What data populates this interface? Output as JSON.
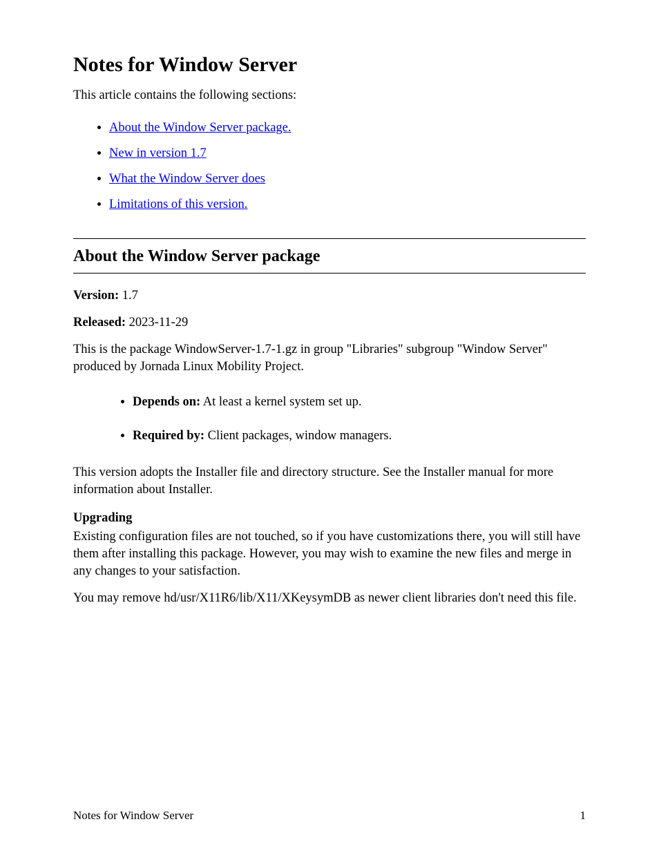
{
  "title": "Notes for Window Server",
  "intro": "This article contains the following sections:",
  "toc_links": [
    "About the Window Server package.",
    "New in version 1.7",
    "What the Window Server does",
    "Limitations of this version."
  ],
  "section": {
    "heading": "About the Window Server package",
    "para1_label": "Version:",
    "para1_text": " 1.7",
    "para2_label": "Released:",
    "para2_text": " 2023-11-29",
    "para3": "This is the package WindowServer-1.7-1.gz in group \"Libraries\" subgroup \"Window Server\" produced by Jornada Linux Mobility Project.",
    "bullet1_label": "Depends on:",
    "bullet1_text": " At least a kernel system set up.",
    "bullet2_label": "Required by:",
    "bullet2_text": " Client packages, window managers.",
    "para4": "This version adopts the Installer file and directory structure. See the Installer manual for more information about Installer.",
    "upgrading_heading": "Upgrading",
    "para5": "Existing configuration files are not touched, so if you have customizations there, you will still have them after installing this package. However, you may wish to examine the new files and merge in any changes to your satisfaction.",
    "para6": "You may remove hd/usr/X11R6/lib/X11/XKeysymDB as newer client libraries don't need this file."
  },
  "footer": {
    "left": "Notes for Window Server",
    "right": "1"
  }
}
